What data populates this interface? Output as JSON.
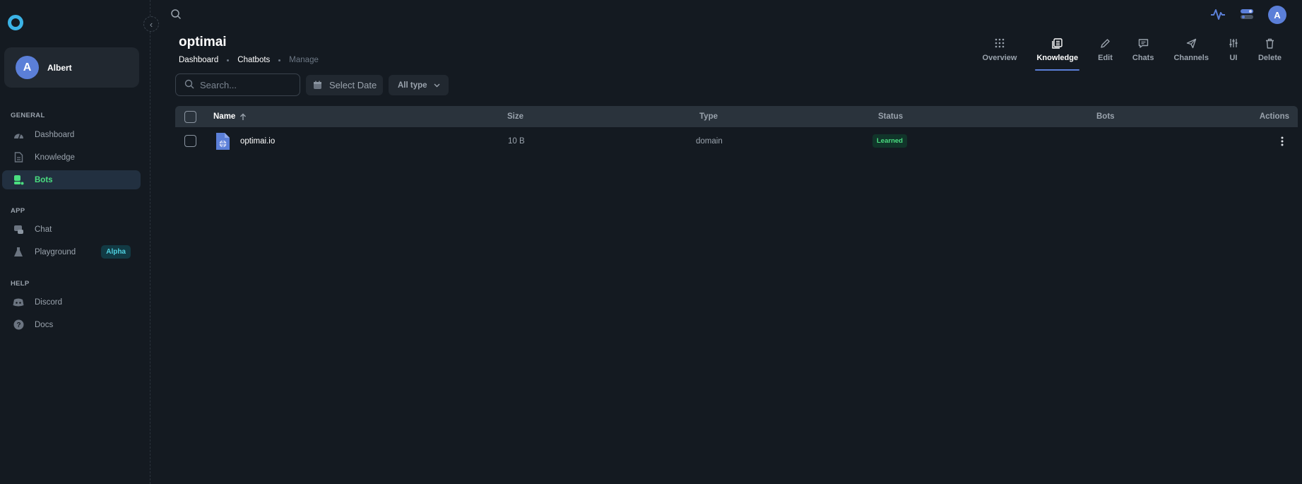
{
  "sidebar": {
    "user": {
      "initial": "A",
      "name": "Albert"
    },
    "sections": [
      {
        "title": "GENERAL",
        "items": [
          {
            "label": "Dashboard",
            "icon": "dashboard-icon"
          },
          {
            "label": "Knowledge",
            "icon": "document-icon"
          },
          {
            "label": "Bots",
            "icon": "bot-icon",
            "active": true
          }
        ]
      },
      {
        "title": "APP",
        "items": [
          {
            "label": "Chat",
            "icon": "chat-icon"
          },
          {
            "label": "Playground",
            "icon": "flask-icon",
            "badge": "Alpha"
          }
        ]
      },
      {
        "title": "HELP",
        "items": [
          {
            "label": "Discord",
            "icon": "discord-icon"
          },
          {
            "label": "Docs",
            "icon": "help-icon"
          }
        ]
      }
    ]
  },
  "topbar": {
    "avatar_initial": "A"
  },
  "header": {
    "title": "optimai",
    "breadcrumb": [
      "Dashboard",
      "Chatbots",
      "Manage"
    ]
  },
  "tabs": [
    {
      "label": "Overview",
      "icon": "grid-icon"
    },
    {
      "label": "Knowledge",
      "icon": "knowledge-icon",
      "active": true
    },
    {
      "label": "Edit",
      "icon": "pencil-icon"
    },
    {
      "label": "Chats",
      "icon": "message-icon"
    },
    {
      "label": "Channels",
      "icon": "send-icon"
    },
    {
      "label": "UI",
      "icon": "sliders-icon"
    },
    {
      "label": "Delete",
      "icon": "trash-icon"
    }
  ],
  "toolbar": {
    "search_placeholder": "Search...",
    "date_label": "Select Date",
    "type_label": "All type"
  },
  "table": {
    "columns": {
      "name": "Name",
      "size": "Size",
      "type": "Type",
      "status": "Status",
      "bots": "Bots",
      "actions": "Actions"
    },
    "rows": [
      {
        "name": "optimai.io",
        "size": "10 B",
        "type": "domain",
        "status": "Learned",
        "bots": ""
      }
    ]
  },
  "colors": {
    "accent": "#5b7fd8",
    "active_nav": "#4ade80",
    "background": "#141a21"
  }
}
